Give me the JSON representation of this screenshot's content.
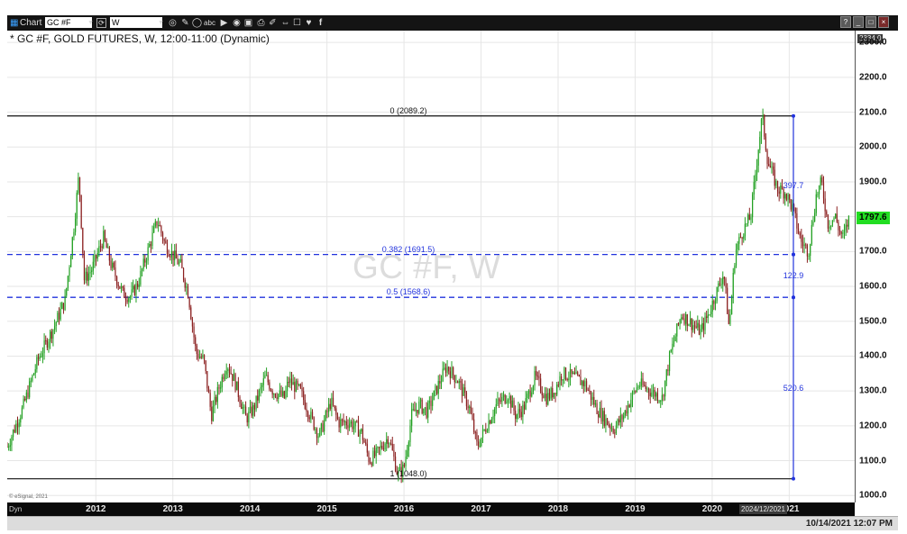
{
  "toolbar": {
    "app_label": "Chart",
    "symbol": "GC #F",
    "interval": "W",
    "icons": [
      "target-icon",
      "pencil-icon",
      "circle-icon",
      "text-tool-icon",
      "play-icon",
      "eye-icon",
      "image-icon",
      "printer-icon",
      "edit-icon",
      "link-icon",
      "chat-icon",
      "twitter-icon",
      "facebook-icon"
    ],
    "window_buttons": [
      "help-icon",
      "minimize-icon",
      "maximize-icon",
      "close-icon"
    ]
  },
  "chart": {
    "title": "* GC #F, GOLD FUTURES, W, 12:00-11:00 (Dynamic)",
    "watermark": "GC #F, W",
    "copyright": "© eSignal, 2021",
    "timebar_label": "Dyn",
    "crosshair_date": "2024/12/2021",
    "status_datetime": "10/14/2021 12:07 PM",
    "y_top_readout": "2334.0",
    "last_price_label": "1797.6"
  },
  "chart_data": {
    "type": "candlestick",
    "title": "* GC #F, GOLD FUTURES, W, 12:00-11:00 (Dynamic)",
    "xlabel": "",
    "ylabel": "",
    "x_ticks": [
      "2012",
      "2013",
      "2014",
      "2015",
      "2016",
      "2017",
      "2018",
      "2019",
      "2020",
      "2021"
    ],
    "y_ticks": [
      1000.0,
      1100.0,
      1200.0,
      1300.0,
      1400.0,
      1500.0,
      1600.0,
      1700.0,
      1800.0,
      1900.0,
      2000.0,
      2100.0,
      2200.0,
      2300.0
    ],
    "ylim": [
      980,
      2334
    ],
    "xlim": [
      2010.85,
      2021.85
    ],
    "grid": true,
    "colors": {
      "up": "#22a022",
      "down": "#8b2020",
      "fib": "#2233dd",
      "range": "#111111",
      "last": "#22dd22"
    },
    "last_price": 1797.6,
    "price_path": [
      [
        2010.85,
        1140
      ],
      [
        2011.05,
        1250
      ],
      [
        2011.25,
        1390
      ],
      [
        2011.45,
        1480
      ],
      [
        2011.6,
        1560
      ],
      [
        2011.72,
        1780
      ],
      [
        2011.78,
        1920
      ],
      [
        2011.85,
        1620
      ],
      [
        2011.95,
        1650
      ],
      [
        2012.1,
        1740
      ],
      [
        2012.2,
        1660
      ],
      [
        2012.35,
        1580
      ],
      [
        2012.45,
        1570
      ],
      [
        2012.55,
        1610
      ],
      [
        2012.7,
        1720
      ],
      [
        2012.8,
        1790
      ],
      [
        2012.9,
        1720
      ],
      [
        2013.0,
        1690
      ],
      [
        2013.1,
        1660
      ],
      [
        2013.2,
        1580
      ],
      [
        2013.3,
        1410
      ],
      [
        2013.4,
        1390
      ],
      [
        2013.5,
        1230
      ],
      [
        2013.6,
        1310
      ],
      [
        2013.7,
        1380
      ],
      [
        2013.8,
        1330
      ],
      [
        2013.95,
        1220
      ],
      [
        2014.05,
        1250
      ],
      [
        2014.2,
        1340
      ],
      [
        2014.3,
        1300
      ],
      [
        2014.45,
        1280
      ],
      [
        2014.5,
        1330
      ],
      [
        2014.65,
        1300
      ],
      [
        2014.8,
        1220
      ],
      [
        2014.9,
        1170
      ],
      [
        2015.05,
        1270
      ],
      [
        2015.15,
        1210
      ],
      [
        2015.3,
        1210
      ],
      [
        2015.45,
        1180
      ],
      [
        2015.55,
        1100
      ],
      [
        2015.65,
        1120
      ],
      [
        2015.8,
        1170
      ],
      [
        2015.92,
        1060
      ],
      [
        2016.0,
        1080
      ],
      [
        2016.1,
        1230
      ],
      [
        2016.2,
        1260
      ],
      [
        2016.3,
        1240
      ],
      [
        2016.45,
        1320
      ],
      [
        2016.55,
        1370
      ],
      [
        2016.7,
        1330
      ],
      [
        2016.85,
        1250
      ],
      [
        2016.95,
        1140
      ],
      [
        2017.05,
        1190
      ],
      [
        2017.2,
        1260
      ],
      [
        2017.35,
        1290
      ],
      [
        2017.45,
        1230
      ],
      [
        2017.55,
        1250
      ],
      [
        2017.7,
        1340
      ],
      [
        2017.85,
        1280
      ],
      [
        2017.95,
        1300
      ],
      [
        2018.05,
        1350
      ],
      [
        2018.2,
        1340
      ],
      [
        2018.35,
        1320
      ],
      [
        2018.5,
        1250
      ],
      [
        2018.6,
        1220
      ],
      [
        2018.72,
        1190
      ],
      [
        2018.85,
        1230
      ],
      [
        2018.95,
        1280
      ],
      [
        2019.05,
        1320
      ],
      [
        2019.2,
        1300
      ],
      [
        2019.35,
        1280
      ],
      [
        2019.45,
        1400
      ],
      [
        2019.6,
        1520
      ],
      [
        2019.7,
        1500
      ],
      [
        2019.85,
        1470
      ],
      [
        2019.95,
        1520
      ],
      [
        2020.05,
        1580
      ],
      [
        2020.15,
        1640
      ],
      [
        2020.22,
        1480
      ],
      [
        2020.3,
        1700
      ],
      [
        2020.4,
        1760
      ],
      [
        2020.5,
        1800
      ],
      [
        2020.6,
        2000
      ],
      [
        2020.65,
        2089
      ],
      [
        2020.72,
        1960
      ],
      [
        2020.85,
        1880
      ],
      [
        2020.95,
        1870
      ],
      [
        2021.05,
        1820
      ],
      [
        2021.15,
        1730
      ],
      [
        2021.25,
        1700
      ],
      [
        2021.35,
        1860
      ],
      [
        2021.42,
        1900
      ],
      [
        2021.5,
        1780
      ],
      [
        2021.6,
        1800
      ],
      [
        2021.65,
        1760
      ],
      [
        2021.7,
        1740
      ],
      [
        2021.78,
        1797.6
      ]
    ],
    "fibonacci": {
      "levels": [
        {
          "label": "0 (2089.2)",
          "value": 2089.2,
          "color": "#111111"
        },
        {
          "label": "0.382 (1691.5)",
          "value": 1691.5,
          "color": "#2233dd"
        },
        {
          "label": "0.5 (1568.6)",
          "value": 1568.6,
          "color": "#2233dd"
        },
        {
          "label": "1 (1048.0)",
          "value": 1048.0,
          "color": "#111111"
        }
      ],
      "measures": [
        {
          "label": "397.7",
          "from": 2089.2,
          "to": 1691.5
        },
        {
          "label": "122.9",
          "from": 1691.5,
          "to": 1568.6
        },
        {
          "label": "520.6",
          "from": 1568.6,
          "to": 1048.0
        }
      ]
    }
  }
}
